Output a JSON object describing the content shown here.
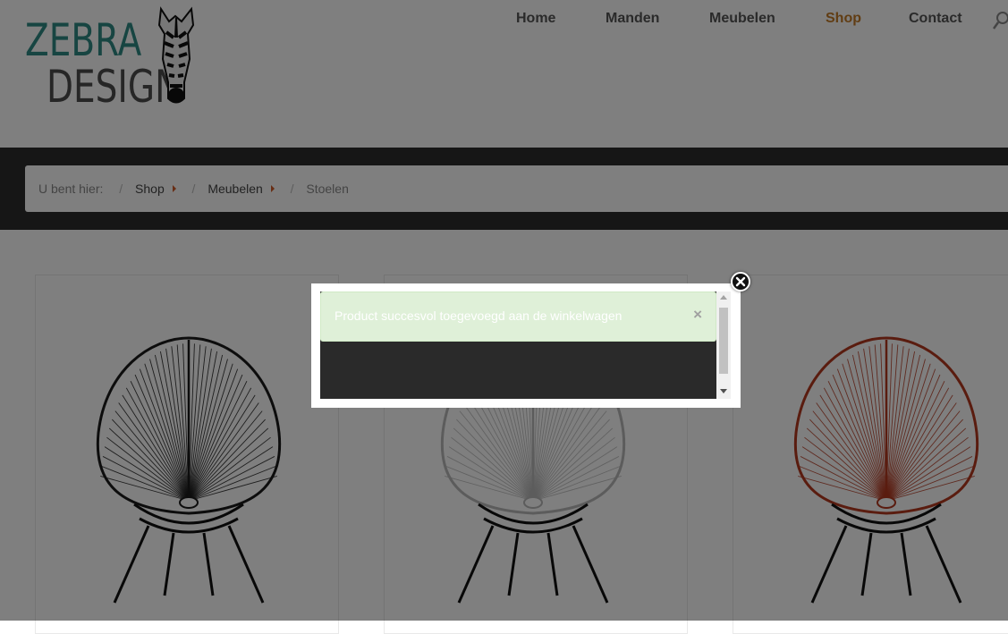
{
  "brand": {
    "line1": "ZEBRA",
    "line2": "DESIGN",
    "colors": {
      "teal": "#2e8a84",
      "dark": "#4d4d4d"
    }
  },
  "nav": {
    "items": [
      {
        "label": "Home",
        "active": false
      },
      {
        "label": "Manden",
        "active": false
      },
      {
        "label": "Meubelen",
        "active": false
      },
      {
        "label": "Shop",
        "active": true
      },
      {
        "label": "Contact",
        "active": false
      }
    ],
    "active_color": "#c27a27",
    "search_icon": "search-icon"
  },
  "breadcrumb": {
    "prefix": "U bent hier:",
    "links": [
      "Shop",
      "Meubelen"
    ],
    "current": "Stoelen",
    "separator": "/"
  },
  "products": [
    {
      "chair_color": "#1a1a1a"
    },
    {
      "chair_color": "#f5f5f5"
    },
    {
      "chair_color": "#b4381f"
    }
  ],
  "modal": {
    "message": "Product succesvol toegevoegd aan de winkelwagen",
    "dismiss_glyph": "×",
    "close_icon": "close-circle-icon",
    "alert_color": "#dff0d8"
  }
}
